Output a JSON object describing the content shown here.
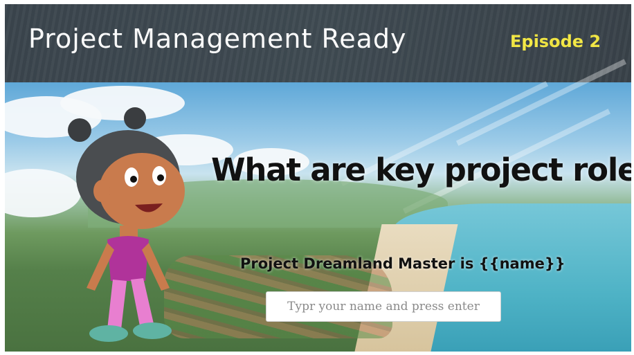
{
  "header": {
    "title": "Project Management Ready",
    "episode": "Episode 2"
  },
  "main": {
    "question": "What are key project roles?",
    "master_line": "Project Dreamland Master is {{name}}",
    "name_input": {
      "value": "",
      "placeholder": "Typr your name and press enter"
    }
  },
  "colors": {
    "header_bg": "#3f4a52",
    "title_text": "#ffffff",
    "episode_text": "#f4e842",
    "question_text": "#111111"
  },
  "icons": {
    "character": "cartoon-girl-illustration",
    "background": "coastal-town-landscape-illustration"
  }
}
